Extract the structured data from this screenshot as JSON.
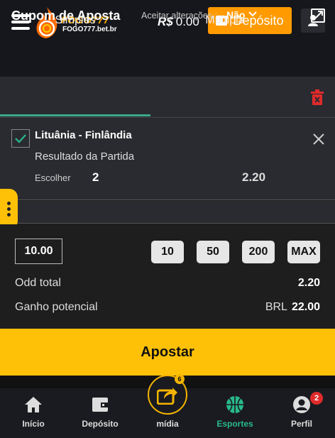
{
  "header": {
    "logo_text": "FOGO777",
    "logo_domain": "FOGO777.bet.br",
    "balance_currency": "R$",
    "balance_value": "0.00",
    "deposit_label": "Depósito"
  },
  "coupon": {
    "title": "Cupom de Aposta",
    "accept_label": "Aceitar alterações :",
    "accept_value": "Não"
  },
  "tabs": {
    "simple": "Simples",
    "multiple": "Múltipla"
  },
  "bet": {
    "match": "Lituânia - Finlândia",
    "market": "Resultado da Partida",
    "choose_label": "Escolher",
    "selection": "2",
    "odd": "2.20"
  },
  "stake": {
    "value": "10.00",
    "quick": [
      "10",
      "50",
      "200",
      "MAX"
    ],
    "odd_total_label": "Odd total",
    "odd_total_value": "2.20",
    "gain_label": "Ganho potencial",
    "gain_currency": "BRL",
    "gain_value": "22.00"
  },
  "apostar_label": "Apostar",
  "nav": {
    "items": [
      {
        "label": "Início"
      },
      {
        "label": "Depósito"
      },
      {
        "label": "mídia"
      },
      {
        "label": "Esportes"
      },
      {
        "label": "Perfil"
      }
    ],
    "midia_badge": "6",
    "perfil_badge": "2"
  },
  "colors": {
    "accent_yellow": "#ffc107",
    "deposit_orange": "#ff9a00",
    "active_green": "#28b98a",
    "danger_red": "#e02b2b"
  }
}
